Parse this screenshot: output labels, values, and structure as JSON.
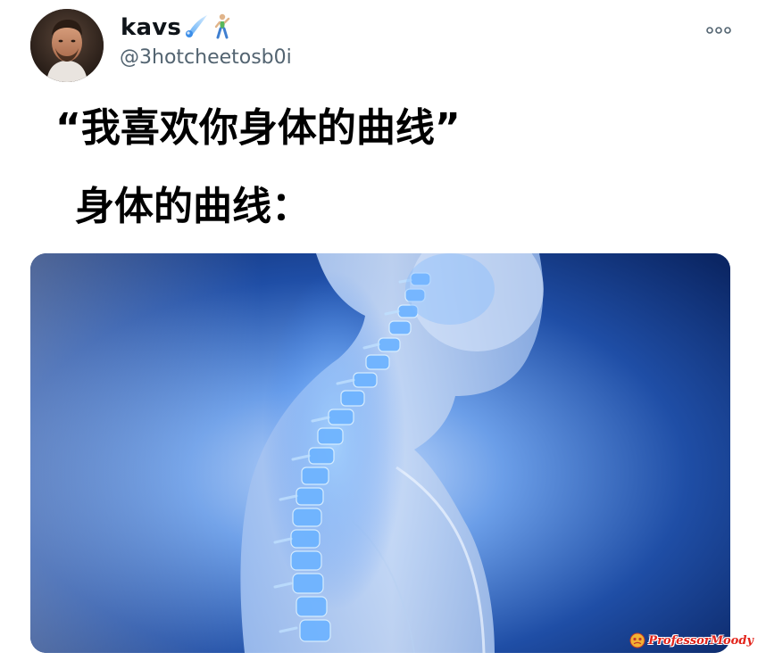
{
  "tweet": {
    "author": {
      "display_name": "kavs",
      "name_emojis": [
        "comet-icon",
        "person-walking-icon"
      ],
      "handle": "@3hotcheetosb0i",
      "avatar": "avatar"
    },
    "more_icon": "more-options-icon",
    "text_lines": [
      "“我喜欢你身体的曲线”",
      "身体的曲线："
    ],
    "media": {
      "kind": "image",
      "subject": "spine-illustration"
    }
  },
  "watermark": {
    "text": "ProfessorMoody",
    "icon": "moody-face-icon"
  },
  "colors": {
    "name": "#0f1419",
    "handle": "#536471",
    "text": "#000000",
    "media_dark": "#0d2d6e",
    "media_glow": "#4d8ff0",
    "watermark": "#e2231a"
  }
}
